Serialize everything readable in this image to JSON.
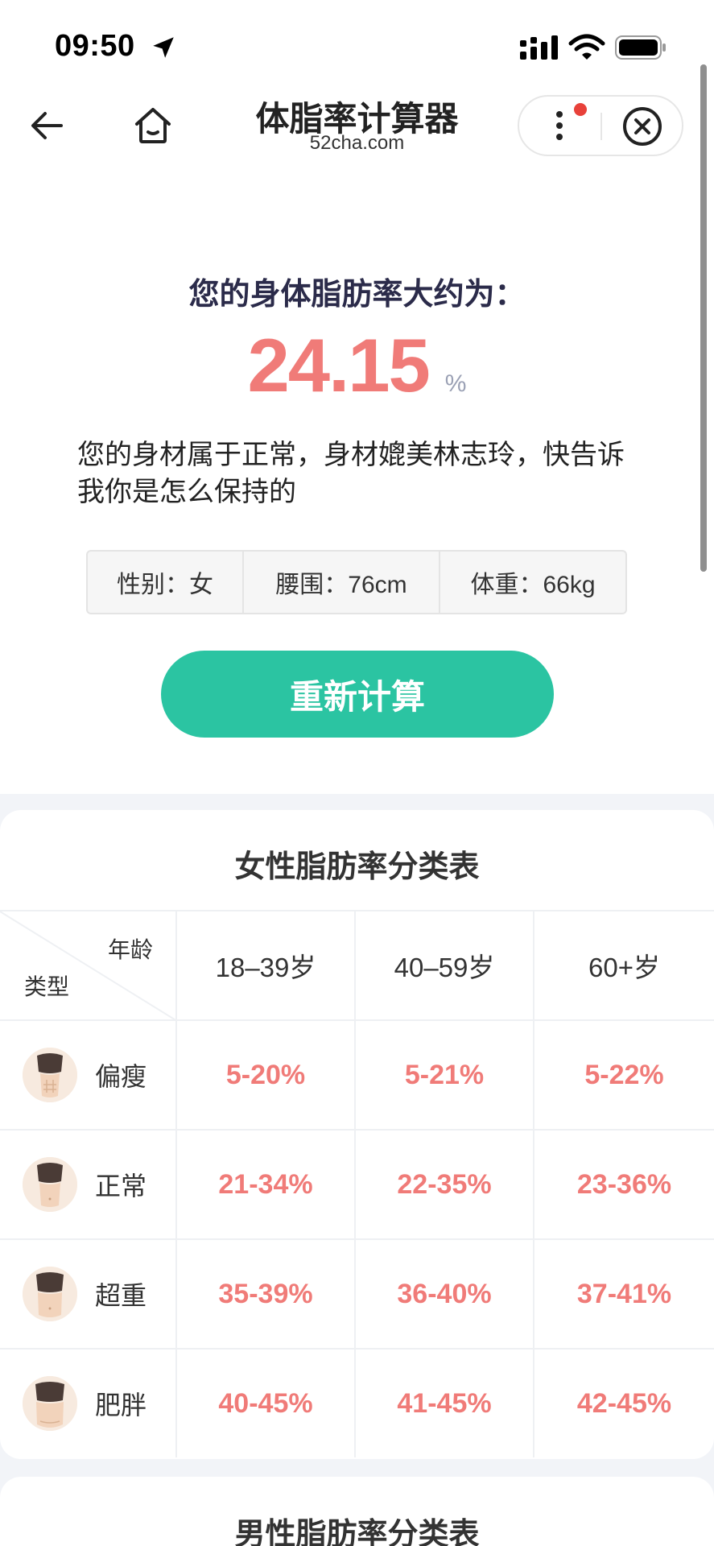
{
  "status_bar": {
    "time": "09:50",
    "icons": [
      "location-arrow-icon",
      "signal-icon",
      "wifi-icon",
      "battery-icon"
    ]
  },
  "nav": {
    "title": "体脂率计算器",
    "subtitle": "52cha.com",
    "icons": [
      "back-arrow-icon",
      "home-icon",
      "more-icon",
      "close-circle-icon"
    ],
    "notification_color": "#e8413a"
  },
  "result": {
    "heading": "您的身体脂肪率大约为：",
    "value": "24.15",
    "unit": "%",
    "description": "您的身材属于正常，身材媲美林志玲，快告诉我你是怎么保持的",
    "value_color": "#f07b78"
  },
  "info": {
    "gender": "性别：女",
    "waist": "腰围：76cm",
    "weight": "体重：66kg"
  },
  "recalc_button": {
    "label": "重新计算",
    "color": "#2bc4a2"
  },
  "female_table": {
    "title": "女性脂肪率分类表",
    "corner_age": "年龄",
    "corner_type": "类型",
    "columns": [
      "18–39岁",
      "40–59岁",
      "60+岁"
    ],
    "rows": [
      {
        "type": "偏瘦",
        "values": [
          "5-20%",
          "5-21%",
          "5-22%"
        ]
      },
      {
        "type": "正常",
        "values": [
          "21-34%",
          "22-35%",
          "23-36%"
        ]
      },
      {
        "type": "超重",
        "values": [
          "35-39%",
          "36-40%",
          "37-41%"
        ]
      },
      {
        "type": "肥胖",
        "values": [
          "40-45%",
          "41-45%",
          "42-45%"
        ]
      }
    ]
  },
  "male_table": {
    "title": "男性脂肪率分类表"
  }
}
